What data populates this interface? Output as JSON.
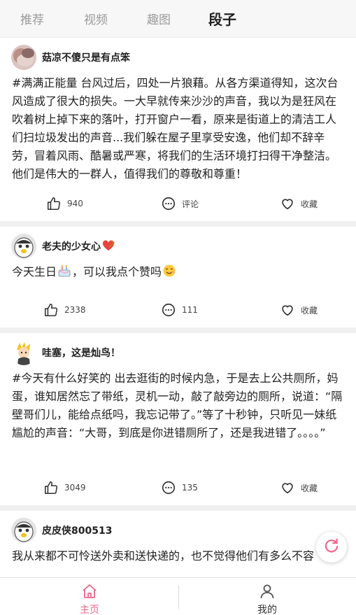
{
  "top_tabs": [
    {
      "label": "推荐"
    },
    {
      "label": "视频"
    },
    {
      "label": "趣图"
    },
    {
      "label": "段子"
    }
  ],
  "posts": [
    {
      "username": "菇凉不傻只是有点笨",
      "content": "#满满正能量 台风过后，四处一片狼藉。从各方渠道得知，这次台风造成了很大的损失。一大早就传来沙沙的声音，我以为是狂风在吹着树上掉下来的落叶，打开窗户一看，原来是街道上的清洁工人们扫垃圾发出的声音...我们躲在屋子里享受安逸，他们却不辞辛劳，冒着风雨、酷暑或严寒，将我们的生活环境打扫得干净整洁。他们是伟大的一群人，值得我们的尊敬和尊重！",
      "likes": "940",
      "comments": "评论",
      "favorite": "收藏"
    },
    {
      "username": "老夫的少女心",
      "content": "今天生日",
      "content_tail": "，可以我点个赞吗",
      "likes": "2338",
      "comments": "111",
      "favorite": "收藏"
    },
    {
      "username": "哇塞，这是灿鸟！",
      "content": "#今天有什么好笑的 出去逛街的时候内急，于是去上公共厕所，妈蛋，谁知居然忘了带纸，灵机一动，敲了敲旁边的厕所，说道：“隔壁哥们儿，能给点纸吗，我忘记带了。”等了十秒钟，只听见一妹纸尴尬的声音：“大哥，到底是你进错厕所了，还是我进错了。。。。”",
      "likes": "3049",
      "comments": "135",
      "favorite": "收藏"
    },
    {
      "username": "皮皮侠800513",
      "content": "我从来都不可怜送外卖和送快递的，也不觉得他们有多么不容"
    }
  ],
  "bottom_nav": [
    {
      "label": "主页"
    },
    {
      "label": "我的"
    }
  ],
  "colors": {
    "accent": "#f0668a",
    "tab_inactive": "#9a9a9a",
    "feed_gap": "#f0f0f0"
  },
  "icons": {
    "like": "thumbs-up-icon",
    "comment": "comment-icon",
    "favorite": "heart-icon",
    "home": "home-icon",
    "profile": "person-icon",
    "refresh": "refresh-icon"
  }
}
